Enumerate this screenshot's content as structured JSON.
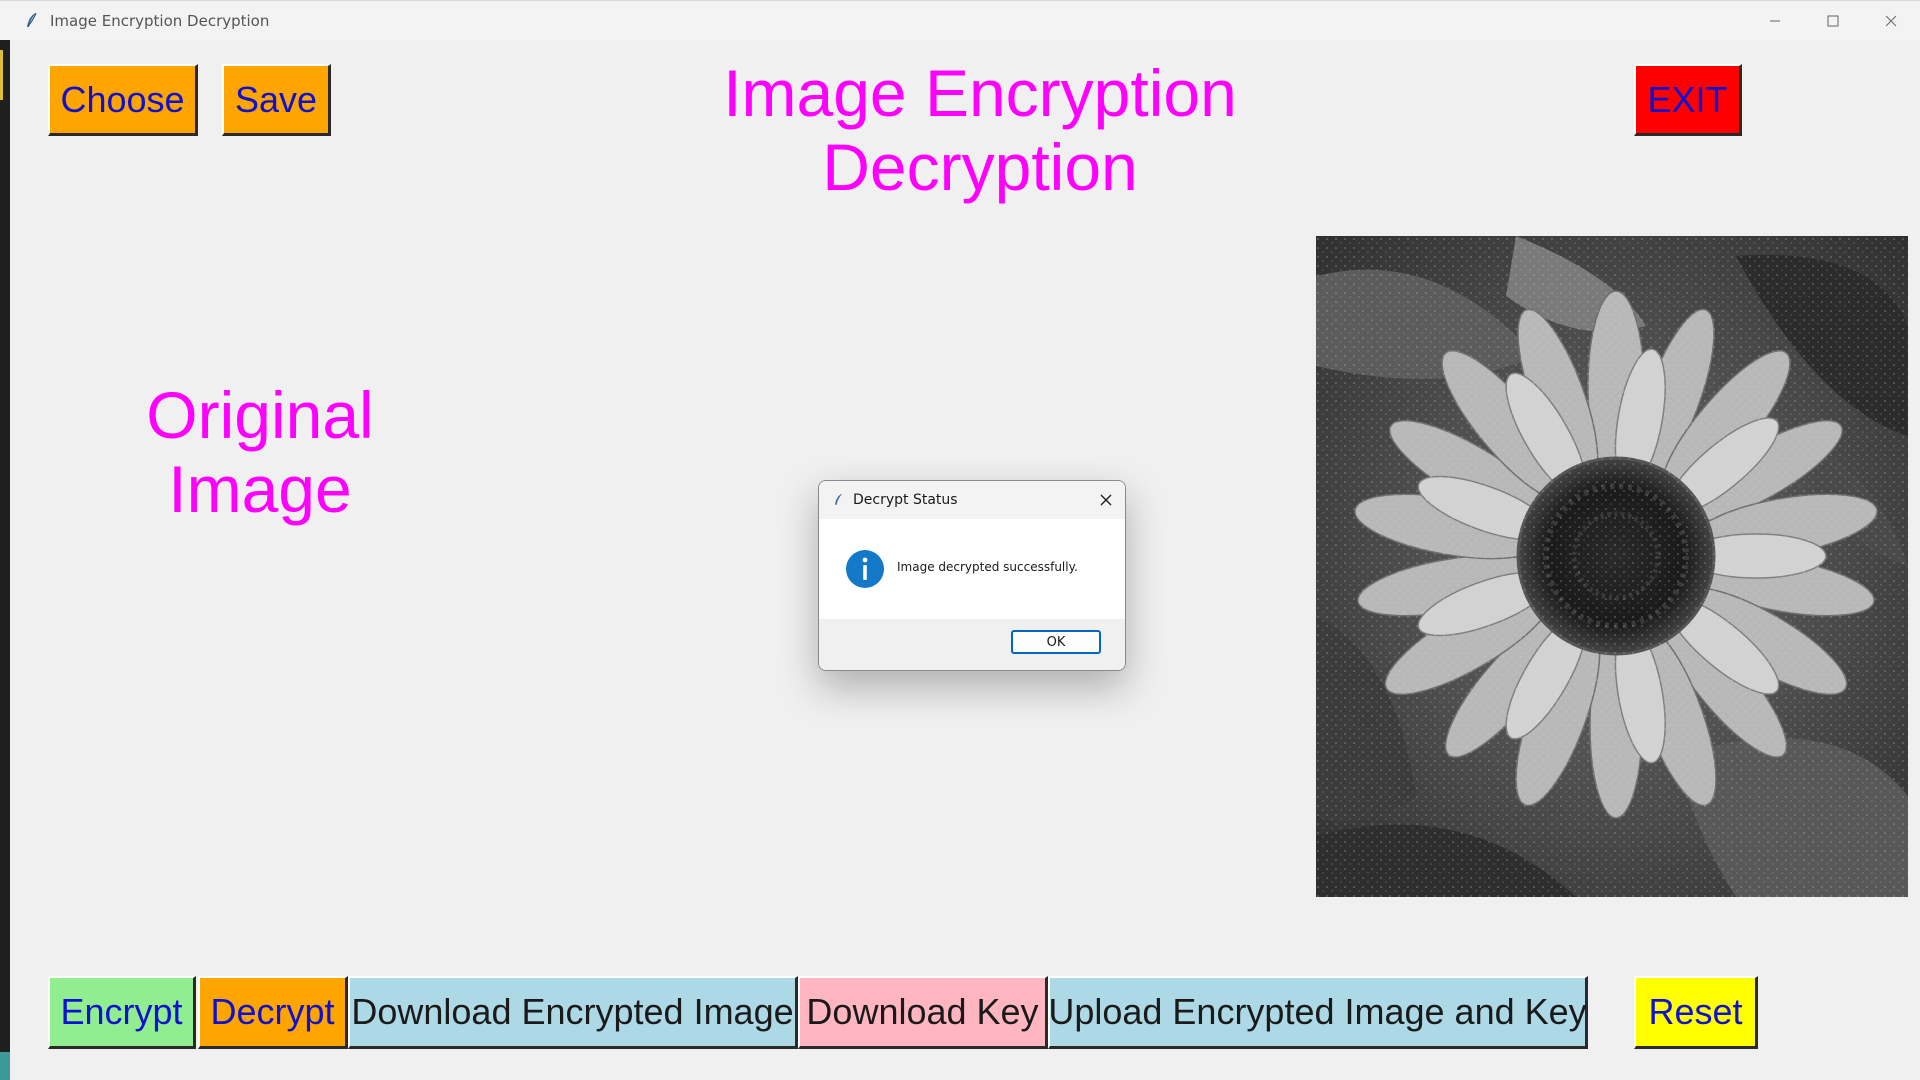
{
  "window": {
    "title": "Image Encryption Decryption",
    "icon": "feather-icon",
    "controls": [
      "minimize-icon",
      "maximize-icon",
      "close-icon"
    ]
  },
  "app": {
    "heading_line1": "Image Encryption",
    "heading_line2": "Decryption",
    "original_label_line1": "Original",
    "original_label_line2": "Image",
    "top_buttons": {
      "choose": "Choose",
      "save": "Save",
      "exit": "EXIT"
    },
    "bottom_buttons": {
      "encrypt": "Encrypt",
      "decrypt": "Decrypt",
      "download_encrypted": "Download Encrypted Image",
      "download_key": "Download Key",
      "upload": "Upload Encrypted Image and Key",
      "reset": "Reset"
    },
    "image": "grayscale-sunflower-photo"
  },
  "dialog": {
    "title": "Decrypt Status",
    "message": "Image decrypted successfully.",
    "ok_label": "OK",
    "icon": "info-icon"
  },
  "colors": {
    "heading": "#ff00ff",
    "button_text": "#1010d0",
    "orange": "#ffa500",
    "red": "#ff0000",
    "light_green": "#90ee90",
    "light_blue": "#add8e6",
    "pink": "#ffb6c1",
    "yellow": "#ffff00"
  }
}
